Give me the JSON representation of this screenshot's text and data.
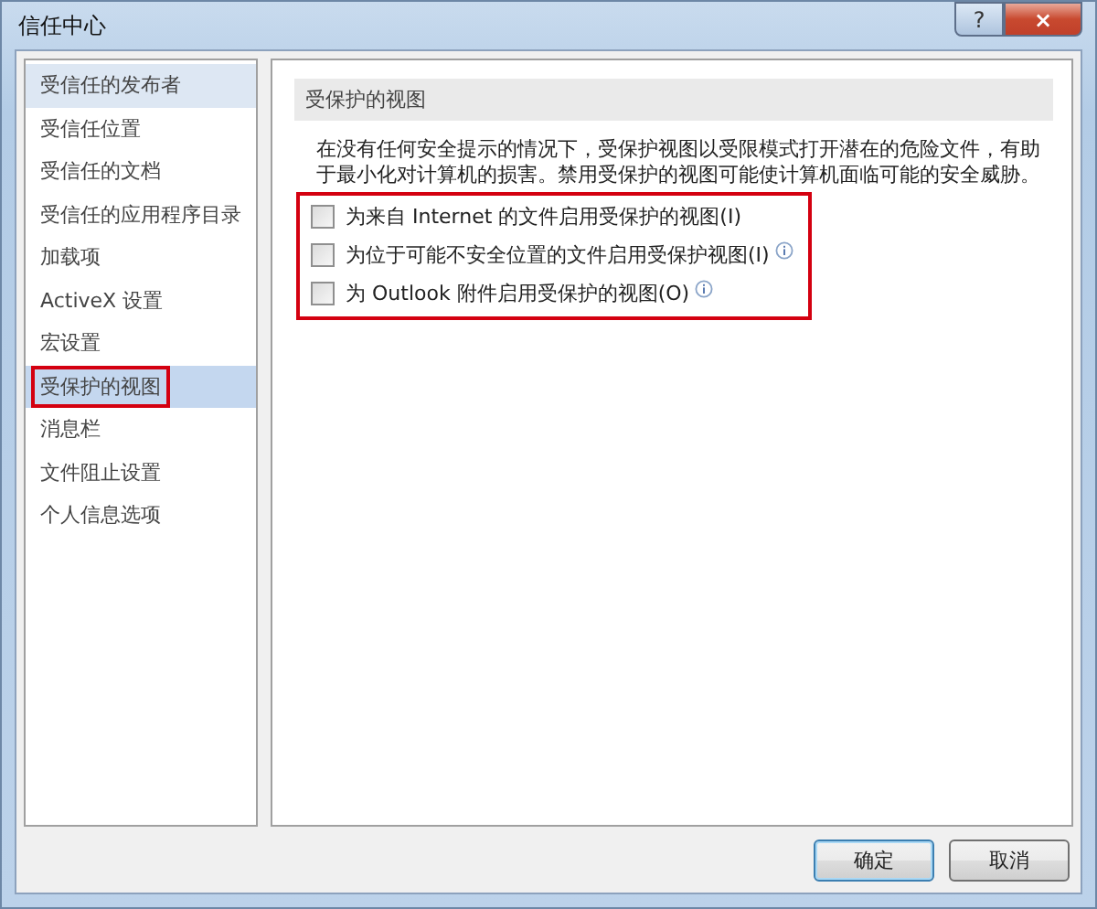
{
  "window": {
    "title": "信任中心"
  },
  "title_buttons": [
    {
      "kind": "help",
      "label": "?"
    },
    {
      "kind": "close",
      "label": "×"
    }
  ],
  "sidebar": {
    "items": [
      {
        "label": "受信任的发布者",
        "selected": false,
        "hovered": true,
        "highlighted": false
      },
      {
        "label": "受信任位置",
        "selected": false,
        "hovered": false,
        "highlighted": false
      },
      {
        "label": "受信任的文档",
        "selected": false,
        "hovered": false,
        "highlighted": false
      },
      {
        "label": "受信任的应用程序目录",
        "selected": false,
        "hovered": false,
        "highlighted": false
      },
      {
        "label": "加载项",
        "selected": false,
        "hovered": false,
        "highlighted": false
      },
      {
        "label": "ActiveX 设置",
        "selected": false,
        "hovered": false,
        "highlighted": false
      },
      {
        "label": "宏设置",
        "selected": false,
        "hovered": false,
        "highlighted": false
      },
      {
        "label": "受保护的视图",
        "selected": true,
        "hovered": false,
        "highlighted": true
      },
      {
        "label": "消息栏",
        "selected": false,
        "hovered": false,
        "highlighted": false
      },
      {
        "label": "文件阻止设置",
        "selected": false,
        "hovered": false,
        "highlighted": false
      },
      {
        "label": "个人信息选项",
        "selected": false,
        "hovered": false,
        "highlighted": false
      }
    ]
  },
  "section": {
    "heading": "受保护的视图",
    "description": "在没有任何安全提示的情况下，受保护视图以受限模式打开潜在的危险文件，有助于最小化对计算机的损害。禁用受保护的视图可能使计算机面临可能的安全威胁。",
    "options_highlighted": true,
    "options": [
      {
        "label": "为来自 Internet 的文件启用受保护的视图(I)",
        "checked": false,
        "info": false
      },
      {
        "label": "为位于可能不安全位置的文件启用受保护视图(I)",
        "checked": false,
        "info": true
      },
      {
        "label": "为 Outlook 附件启用受保护的视图(O)",
        "checked": false,
        "info": true
      }
    ]
  },
  "buttons": [
    {
      "label": "确定",
      "default": true
    },
    {
      "label": "取消",
      "default": false
    }
  ]
}
